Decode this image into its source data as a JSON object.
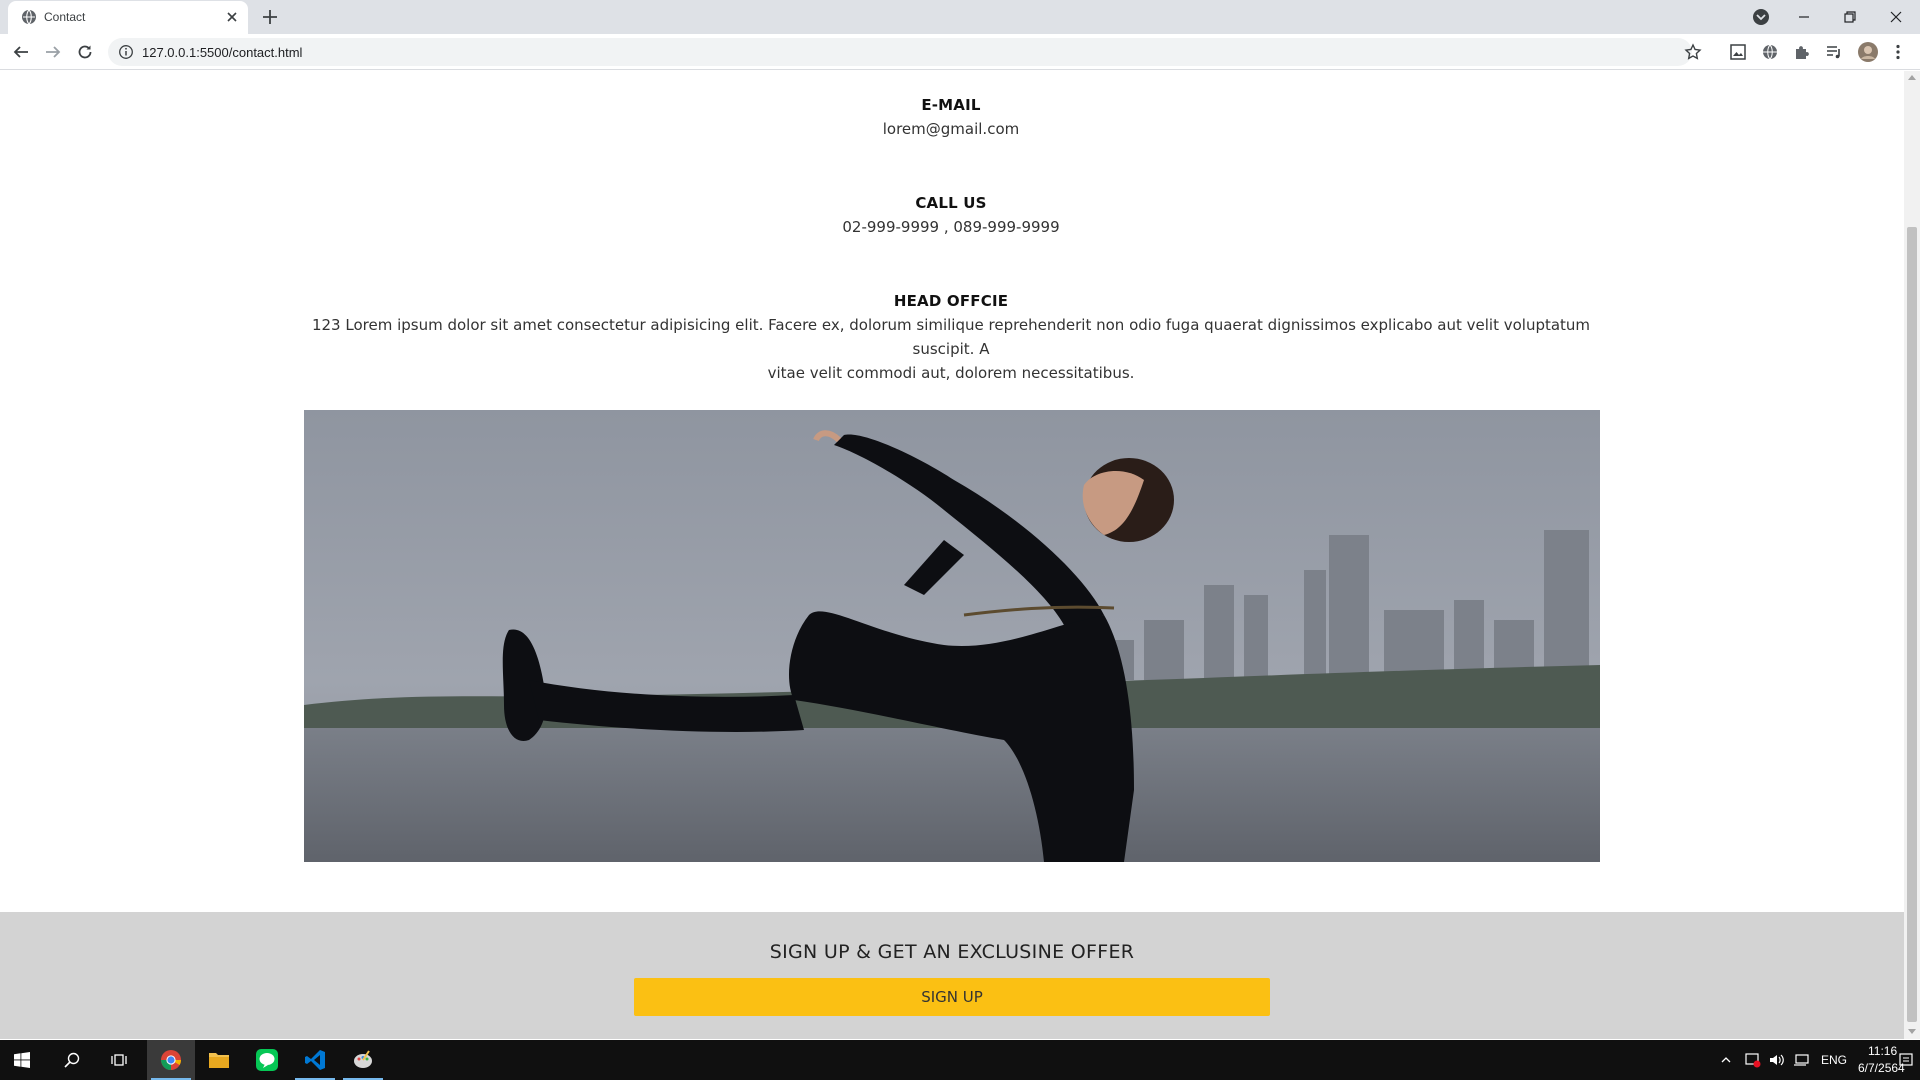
{
  "browser": {
    "tab_title": "Contact",
    "url": "127.0.0.1:5500/contact.html"
  },
  "contact": {
    "email": {
      "heading": "E-MAIL",
      "value": "lorem@gmail.com"
    },
    "phone": {
      "heading": "CALL US",
      "value": "02-999-9999 , 089-999-9999"
    },
    "office": {
      "heading": "HEAD OFFCIE",
      "address_line1": "123 Lorem ipsum dolor sit amet consectetur adipisicing elit. Facere ex, dolorum similique reprehenderit non odio fuga quaerat dignissimos explicabo aut velit voluptatum suscipit. A",
      "address_line2": "vitae velit commodi aut, dolorem necessitatibus."
    }
  },
  "signup": {
    "title": "SIGN UP & GET AN EXCLUSINE OFFER",
    "button_label": "SIGN UP"
  },
  "taskbar": {
    "language": "ENG",
    "time": "11:16",
    "date": "6/7/2564"
  },
  "colors": {
    "accent_yellow": "#fbc013",
    "footer_gray": "#d3d3d3",
    "chrome_frame": "#dee1e6",
    "taskbar": "#101010"
  }
}
